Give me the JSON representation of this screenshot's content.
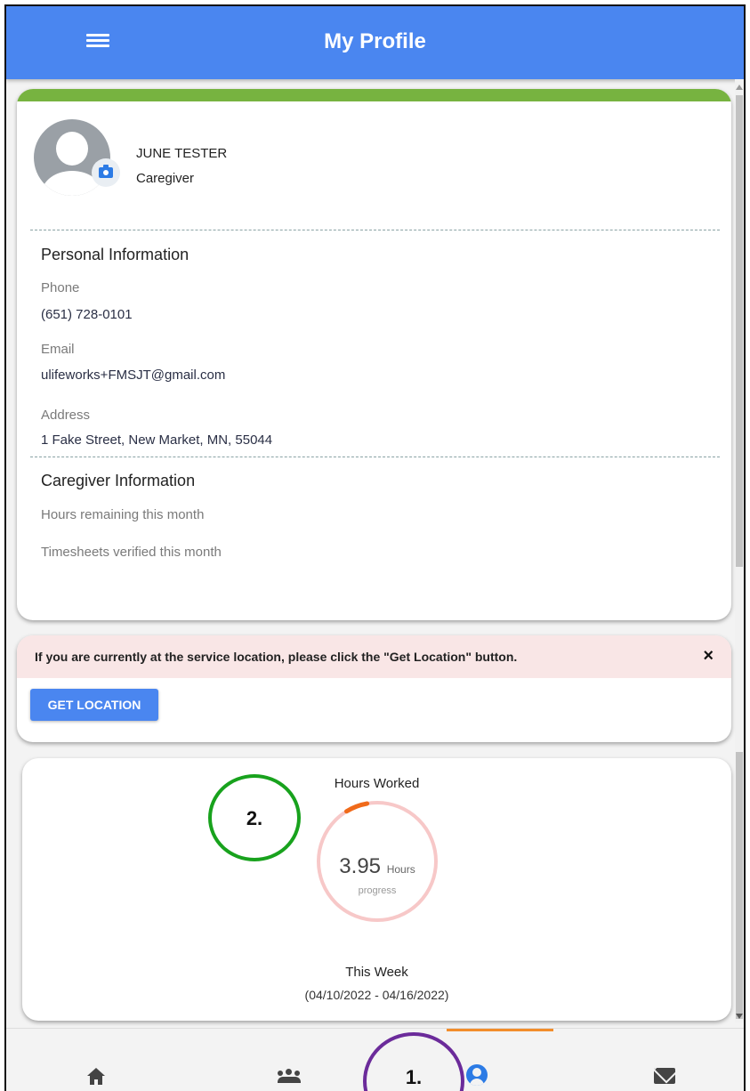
{
  "header": {
    "title": "My Profile",
    "menu_icon": "hamburger-icon"
  },
  "profile": {
    "name": "JUNE TESTER",
    "role": "Caregiver",
    "avatar_icon": "user-avatar-icon",
    "camera_icon": "camera-icon"
  },
  "personal": {
    "title": "Personal Information",
    "phone_label": "Phone",
    "phone_value": "(651) 728-0101",
    "email_label": "Email",
    "email_value": "ulifeworks+FMSJT@gmail.com",
    "address_label": "Address",
    "address_value": "1 Fake Street, New Market, MN, 55044"
  },
  "caregiver": {
    "title": "Caregiver Information",
    "hours_remaining_label": "Hours remaining this month",
    "timesheets_label": "Timesheets verified this month"
  },
  "location": {
    "message": "If you are currently at the service location, please click the \"Get Location\" button.",
    "close_label": "×",
    "button_label": "GET LOCATION"
  },
  "hours": {
    "title": "Hours Worked",
    "value": "3.95",
    "unit": "Hours",
    "caption": "progress",
    "progress_fraction": 0.06,
    "week_title": "This Week",
    "week_range": "(04/10/2022 - 04/16/2022)"
  },
  "nav": {
    "items": [
      {
        "icon": "home-icon"
      },
      {
        "icon": "users-icon"
      },
      {
        "icon": "profile-icon",
        "active": true
      },
      {
        "icon": "mail-icon"
      }
    ]
  },
  "annotations": {
    "one": "1.",
    "two": "2."
  },
  "colors": {
    "header": "#4a86f0",
    "green_bar": "#77b340",
    "progress": "#f06a1a",
    "progress_track": "#f7c8c8",
    "annotation_1": "#6b2b9a",
    "annotation_2": "#18a21d"
  }
}
